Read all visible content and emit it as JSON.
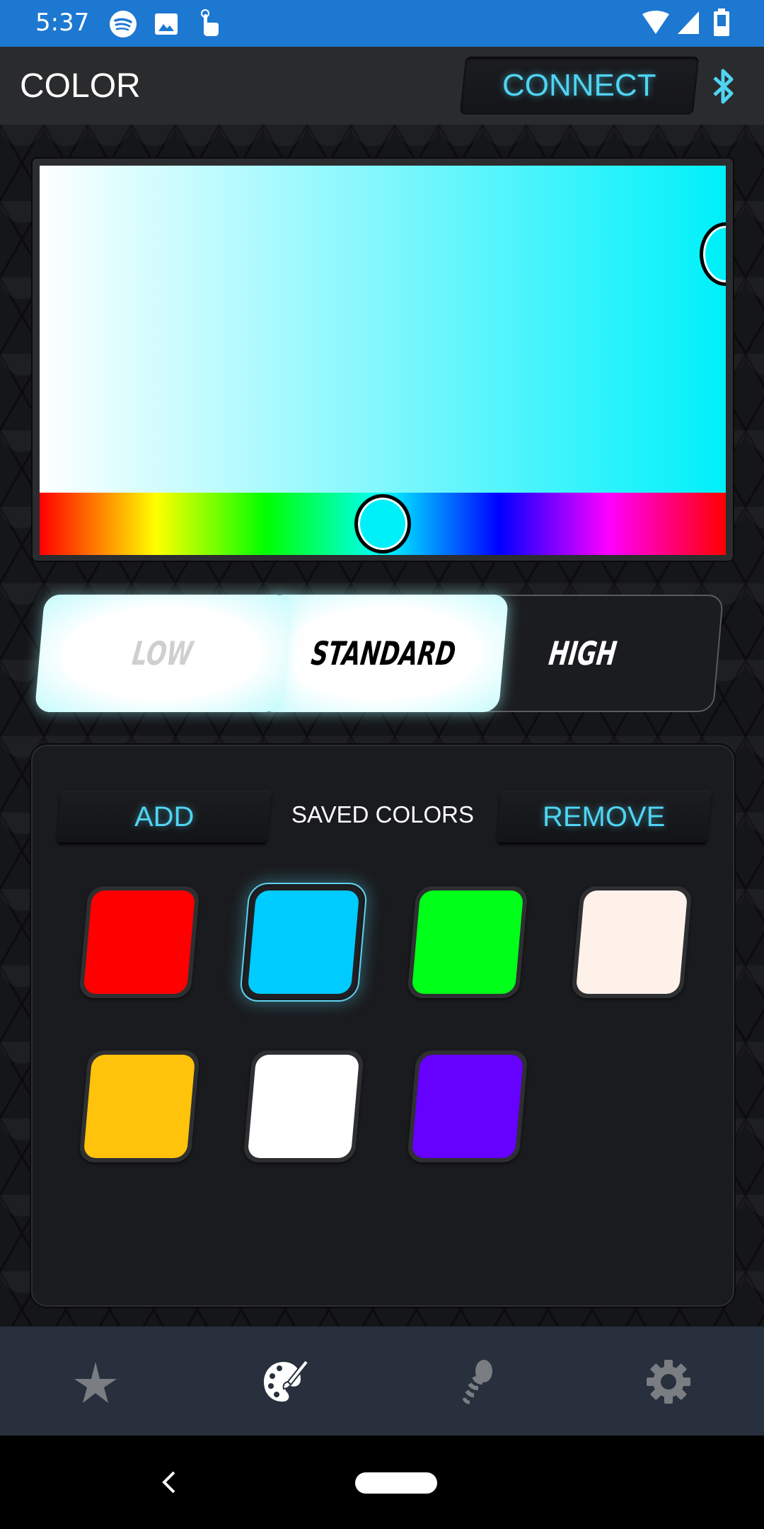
{
  "status_bar": {
    "time": "5:37",
    "left_icons": [
      "spotify-icon",
      "gallery-icon",
      "touch-icon"
    ],
    "right_icons": [
      "wifi-icon",
      "signal-icon",
      "battery-icon"
    ],
    "bg_color": "#1d78d2"
  },
  "app_bar": {
    "title": "COLOR",
    "connect_label": "CONNECT",
    "bluetooth_icon": "bluetooth-icon",
    "accent_color": "#4fd4f2"
  },
  "color_picker": {
    "selected_color": "#00f0fa",
    "hue_position_fraction": 0.5,
    "saturation_fraction": 1.0,
    "value_fraction": 0.73
  },
  "brightness": {
    "options": [
      "LOW",
      "STANDARD",
      "HIGH"
    ],
    "selected": "STANDARD"
  },
  "saved_colors": {
    "title": "SAVED COLORS",
    "add_label": "ADD",
    "remove_label": "REMOVE",
    "swatches": [
      {
        "color": "#ff0000",
        "selected": false
      },
      {
        "color": "#00cbff",
        "selected": true
      },
      {
        "color": "#00ff19",
        "selected": false
      },
      {
        "color": "#fdf1ea",
        "selected": false
      },
      {
        "color": "#ffc30b",
        "selected": false
      },
      {
        "color": "#ffffff",
        "selected": false
      },
      {
        "color": "#6600ff",
        "selected": false
      }
    ]
  },
  "bottom_nav": {
    "items": [
      {
        "icon": "star-icon",
        "name": "favorites",
        "active": false
      },
      {
        "icon": "palette-icon",
        "name": "color",
        "active": true
      },
      {
        "icon": "microphone-icon",
        "name": "music",
        "active": false
      },
      {
        "icon": "gear-icon",
        "name": "settings",
        "active": false
      }
    ]
  }
}
